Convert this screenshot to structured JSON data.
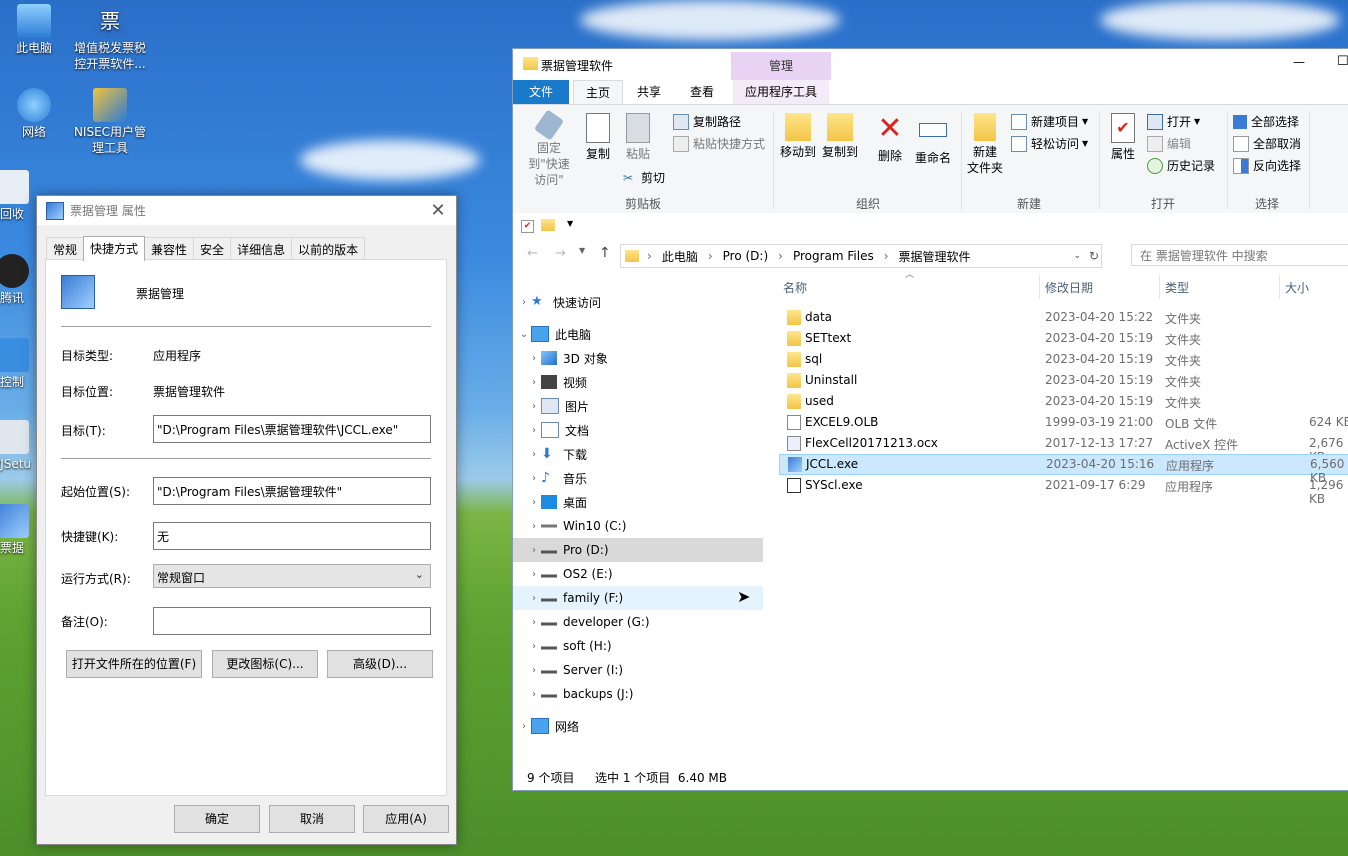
{
  "desktop": {
    "icons": [
      {
        "label": "此电脑"
      },
      {
        "label": "增值税发票税控开票软件..."
      },
      {
        "label": "网络"
      },
      {
        "label": "NISEC用户管理工具"
      },
      {
        "label": "回收"
      },
      {
        "label": "腾讯"
      },
      {
        "label": "控制"
      },
      {
        "label": "PJSetu"
      },
      {
        "label": "票据"
      }
    ]
  },
  "properties": {
    "title": "票据管理 属性",
    "close_glyph": "✕",
    "tabs": [
      "常规",
      "快捷方式",
      "兼容性",
      "安全",
      "详细信息",
      "以前的版本"
    ],
    "active_tab": "快捷方式",
    "app_name": "票据管理",
    "target_type_label": "目标类型:",
    "target_type_value": "应用程序",
    "target_location_label": "目标位置:",
    "target_location_value": "票据管理软件",
    "target_label": "目标(T):",
    "target_value": "\"D:\\Program Files\\票据管理软件\\JCCL.exe\"",
    "start_in_label": "起始位置(S):",
    "start_in_value": "\"D:\\Program Files\\票据管理软件\"",
    "hotkey_label": "快捷键(K):",
    "hotkey_value": "无",
    "run_label": "运行方式(R):",
    "run_value": "常规窗口",
    "comment_label": "备注(O):",
    "comment_value": "",
    "btn_open_location": "打开文件所在的位置(F)",
    "btn_change_icon": "更改图标(C)...",
    "btn_advanced": "高级(D)...",
    "btn_ok": "确定",
    "btn_cancel": "取消",
    "btn_apply": "应用(A)"
  },
  "explorer": {
    "title": "票据管理软件",
    "minimize_glyph": "—",
    "maximize_glyph": "☐",
    "manage_tab": "管理",
    "ribbon_tabs": [
      "文件",
      "主页",
      "共享",
      "查看",
      "应用程序工具"
    ],
    "ribbon": {
      "pin": "固定到\"快速访问\"",
      "copy": "复制",
      "paste": "粘贴",
      "copy_path": "复制路径",
      "paste_shortcut": "粘贴快捷方式",
      "cut": "剪切",
      "group_clipboard": "剪贴板",
      "move_to": "移动到",
      "copy_to": "复制到",
      "delete": "删除",
      "rename": "重命名",
      "group_organize": "组织",
      "new_folder": "新建\n文件夹",
      "new_item": "新建项目",
      "easy_access": "轻松访问",
      "group_new": "新建",
      "properties": "属性",
      "open": "打开",
      "edit": "编辑",
      "history": "历史记录",
      "group_open": "打开",
      "select_all": "全部选择",
      "select_none": "全部取消",
      "invert": "反向选择",
      "group_select": "选择"
    },
    "address": [
      "此电脑",
      "Pro (D:)",
      "Program Files",
      "票据管理软件"
    ],
    "search_placeholder": "在 票据管理软件 中搜索",
    "nav_items": [
      {
        "label": "快速访问",
        "icon": "star-icon"
      },
      {
        "label": "此电脑",
        "icon": "computer-icon"
      },
      {
        "label": "3D 对象",
        "icon": "cube-icon"
      },
      {
        "label": "视频",
        "icon": "video-icon"
      },
      {
        "label": "图片",
        "icon": "picture-icon"
      },
      {
        "label": "文档",
        "icon": "document-icon"
      },
      {
        "label": "下载",
        "icon": "download-icon"
      },
      {
        "label": "音乐",
        "icon": "music-icon"
      },
      {
        "label": "桌面",
        "icon": "desktop-icon"
      },
      {
        "label": "Win10 (C:)",
        "icon": "drive-icon"
      },
      {
        "label": "Pro (D:)",
        "icon": "drive-icon"
      },
      {
        "label": "OS2 (E:)",
        "icon": "drive-icon"
      },
      {
        "label": "family (F:)",
        "icon": "drive-icon"
      },
      {
        "label": "developer (G:)",
        "icon": "drive-icon"
      },
      {
        "label": "soft (H:)",
        "icon": "drive-icon"
      },
      {
        "label": "Server (I:)",
        "icon": "drive-icon"
      },
      {
        "label": "backups (J:)",
        "icon": "drive-icon"
      },
      {
        "label": "网络",
        "icon": "network-icon"
      }
    ],
    "columns": [
      "名称",
      "修改日期",
      "类型",
      "大小"
    ],
    "files": [
      {
        "name": "data",
        "date": "2023-04-20 15:22",
        "type": "文件夹",
        "size": "",
        "kind": "folder"
      },
      {
        "name": "SETtext",
        "date": "2023-04-20 15:19",
        "type": "文件夹",
        "size": "",
        "kind": "folder"
      },
      {
        "name": "sql",
        "date": "2023-04-20 15:19",
        "type": "文件夹",
        "size": "",
        "kind": "folder"
      },
      {
        "name": "Uninstall",
        "date": "2023-04-20 15:19",
        "type": "文件夹",
        "size": "",
        "kind": "folder"
      },
      {
        "name": "used",
        "date": "2023-04-20 15:19",
        "type": "文件夹",
        "size": "",
        "kind": "folder"
      },
      {
        "name": "EXCEL9.OLB",
        "date": "1999-03-19 21:00",
        "type": "OLB 文件",
        "size": "624 KB",
        "kind": "file"
      },
      {
        "name": "FlexCell20171213.ocx",
        "date": "2017-12-13 17:27",
        "type": "ActiveX 控件",
        "size": "2,676 KB",
        "kind": "file"
      },
      {
        "name": "JCCL.exe",
        "date": "2023-04-20 15:16",
        "type": "应用程序",
        "size": "6,560 KB",
        "kind": "exe"
      },
      {
        "name": "SYScl.exe",
        "date": "2021-09-17 6:29",
        "type": "应用程序",
        "size": "1,296 KB",
        "kind": "exe"
      }
    ],
    "status_count": "9 个项目",
    "status_selected": "选中 1 个项目  6.40 MB"
  },
  "colors": {
    "accent": "#1979ca",
    "selected_row": "#cce8ff",
    "manage_tab": "#e8d3f5"
  }
}
